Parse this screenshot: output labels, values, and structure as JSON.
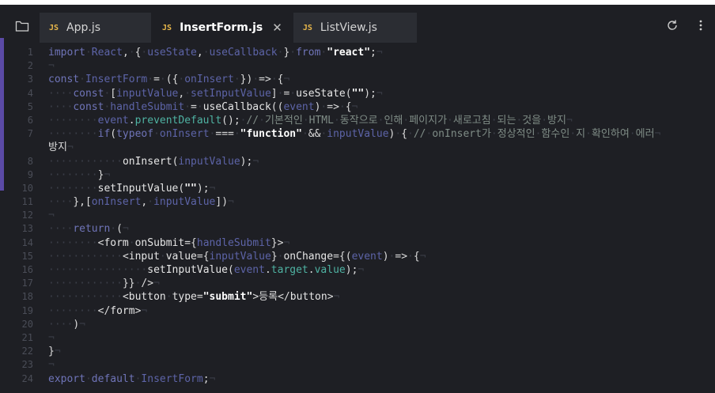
{
  "tabs": [
    {
      "badge": "JS",
      "label": "App.js"
    },
    {
      "badge": "JS",
      "label": "InsertForm.js",
      "close": "✕"
    },
    {
      "badge": "JS",
      "label": "ListView.js"
    }
  ],
  "icons": {
    "folder": "folder-icon",
    "refresh": "refresh-icon",
    "more": "more-vertical-icon"
  },
  "lines": [
    {
      "n": "1",
      "html": "import React, { useState, useCallback } from \"react\";"
    },
    {
      "n": "2",
      "html": ""
    },
    {
      "n": "3",
      "html": "const InsertForm = ({ onInsert }) => {"
    },
    {
      "n": "4",
      "html": "    const [inputValue, setInputValue] = useState(\"\");"
    },
    {
      "n": "5",
      "html": "    const handleSubmit = useCallback((event) => {"
    },
    {
      "n": "6",
      "html": "        event.preventDefault(); // 기본적인 HTML 동작으로 인해 페이지가 새로고침 되는 것을 방지"
    },
    {
      "n": "7",
      "html": "        if(typeof onInsert === \"function\" && inputValue) { // onInsert가 정상적인 함수인 지 확인하여 에러"
    },
    {
      "n": "",
      "html": "방지"
    },
    {
      "n": "8",
      "html": "            onInsert(inputValue);"
    },
    {
      "n": "9",
      "html": "        }"
    },
    {
      "n": "10",
      "html": "        setInputValue(\"\");"
    },
    {
      "n": "11",
      "html": "    },[onInsert, inputValue])"
    },
    {
      "n": "12",
      "html": ""
    },
    {
      "n": "13",
      "html": "    return ("
    },
    {
      "n": "14",
      "html": "        <form onSubmit={handleSubmit}>"
    },
    {
      "n": "15",
      "html": "            <input value={inputValue} onChange={(event) => {"
    },
    {
      "n": "16",
      "html": "                setInputValue(event.target.value);"
    },
    {
      "n": "17",
      "html": "            }} />"
    },
    {
      "n": "18",
      "html": "            <button type=\"submit\">등록</button>"
    },
    {
      "n": "19",
      "html": "        </form>"
    },
    {
      "n": "20",
      "html": "    )"
    },
    {
      "n": "21",
      "html": ""
    },
    {
      "n": "22",
      "html": "}"
    },
    {
      "n": "23",
      "html": ""
    },
    {
      "n": "24",
      "html": "export default InsertForm;"
    }
  ]
}
